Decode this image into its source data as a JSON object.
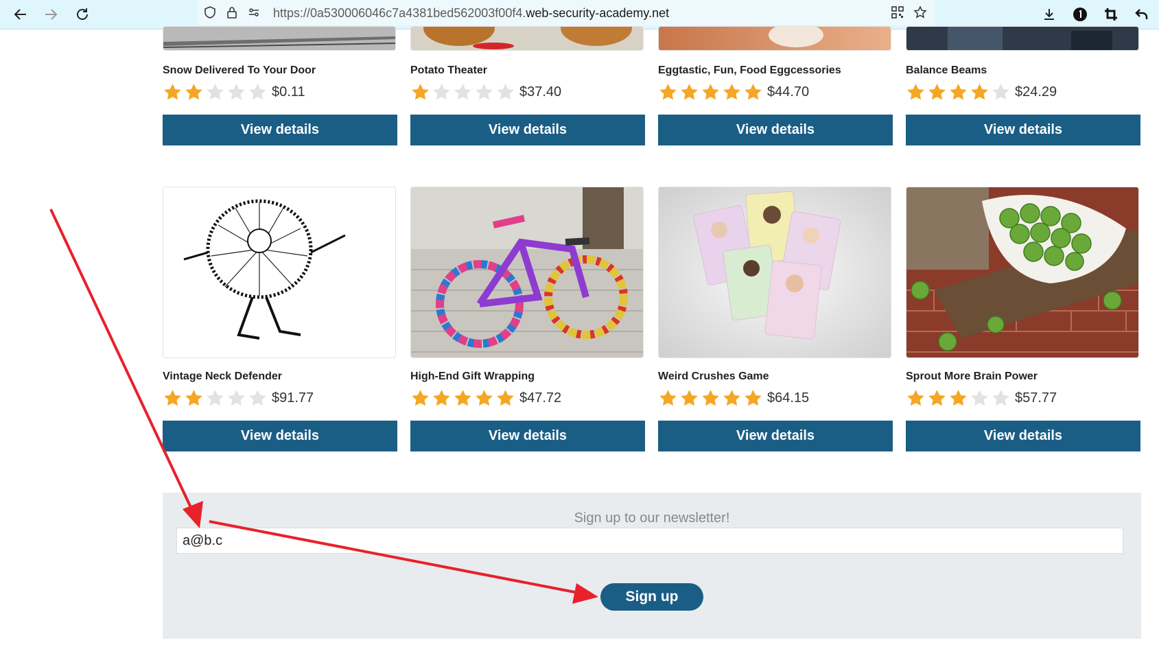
{
  "browser": {
    "url_prefix": "https://0a530006046c7a4381bed562003f00f4.",
    "url_host": "web-security-academy.net"
  },
  "products": [
    {
      "name": "Snow Delivered To Your Door",
      "stars": 2,
      "price": "$0.11",
      "button": "View details",
      "image": "snowy-railway"
    },
    {
      "name": "Potato Theater",
      "stars": 1,
      "price": "$37.40",
      "button": "View details",
      "image": "potatoes"
    },
    {
      "name": "Eggtastic, Fun, Food Eggcessories",
      "stars": 5,
      "price": "$44.70",
      "button": "View details",
      "image": "eggs"
    },
    {
      "name": "Balance Beams",
      "stars": 4,
      "price": "$24.29",
      "button": "View details",
      "image": "balance-beams"
    },
    {
      "name": "Vintage Neck Defender",
      "stars": 2,
      "price": "$91.77",
      "button": "View details",
      "image": "neck-ruff-sketch"
    },
    {
      "name": "High-End Gift Wrapping",
      "stars": 5,
      "price": "$47.72",
      "button": "View details",
      "image": "knitted-bicycle"
    },
    {
      "name": "Weird Crushes Game",
      "stars": 5,
      "price": "$64.15",
      "button": "View details",
      "image": "trump-cards"
    },
    {
      "name": "Sprout More Brain Power",
      "stars": 3,
      "price": "$57.77",
      "button": "View details",
      "image": "brussels-sprouts"
    }
  ],
  "newsletter": {
    "title": "Sign up to our newsletter!",
    "email_value": "a@b.c",
    "button": "Sign up"
  },
  "colors": {
    "button": "#1a5e86",
    "star_filled": "#f5a623",
    "star_empty": "#e2e2e2",
    "annotation_arrow": "#e8212b"
  }
}
